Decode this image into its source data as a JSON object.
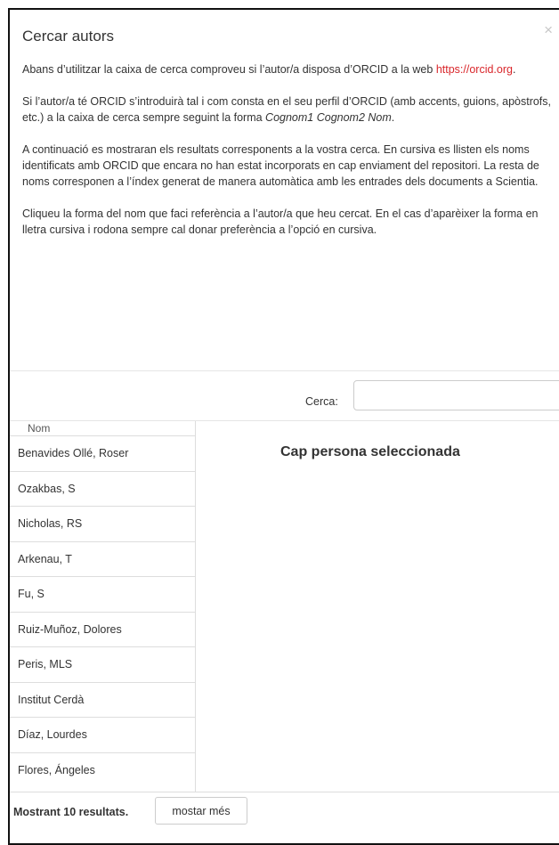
{
  "dialog": {
    "title": "Cercar autors",
    "close_glyph": "×"
  },
  "intro": {
    "p1_text": "Abans d’utilitzar la caixa de cerca comproveu si l’autor/a disposa d’ORCID a la web ",
    "p1_link": "https://orcid.org",
    "p1_end": ".",
    "p2_text": "Si l’autor/a té ORCID s’introduirà tal i com consta en el seu perfil d’ORCID (amb accents, guions, apòstrofs, etc.) a la caixa de cerca sempre seguint la forma ",
    "p2_italic": "Cognom1 Cognom2 Nom",
    "p2_end": ".",
    "p3": "A continuació es mostraran els resultats corresponents a la vostra cerca. En cursiva es llisten els noms identificats amb ORCID que encara no han estat incorporats en cap enviament del repositori. La resta de noms corresponen a l’índex generat de manera automàtica amb les entrades dels documents a Scientia.",
    "p4": "Cliqueu la forma del nom que faci referència a l’autor/a que heu cercat. En el cas d’aparèixer la forma en lletra cursiva i rodona sempre cal donar preferència a l’opció en cursiva."
  },
  "search": {
    "label": "Cerca:",
    "value": "",
    "placeholder": ""
  },
  "list": {
    "header": "Nom",
    "items": [
      "Benavides Ollé, Roser",
      "Ozakbas, S",
      "Nicholas, RS",
      "Arkenau, T",
      "Fu, S",
      "Ruiz-Muñoz, Dolores",
      "Peris, MLS",
      "Institut Cerdà",
      "Díaz, Lourdes",
      "Flores, Ángeles"
    ]
  },
  "detail": {
    "empty_message": "Cap persona seleccionada"
  },
  "footer": {
    "results_count": "Mostrant 10 resultats.",
    "more_button": "mostar més"
  },
  "colors": {
    "link": "#d9262b",
    "text": "#333333",
    "border": "#dddddd"
  }
}
